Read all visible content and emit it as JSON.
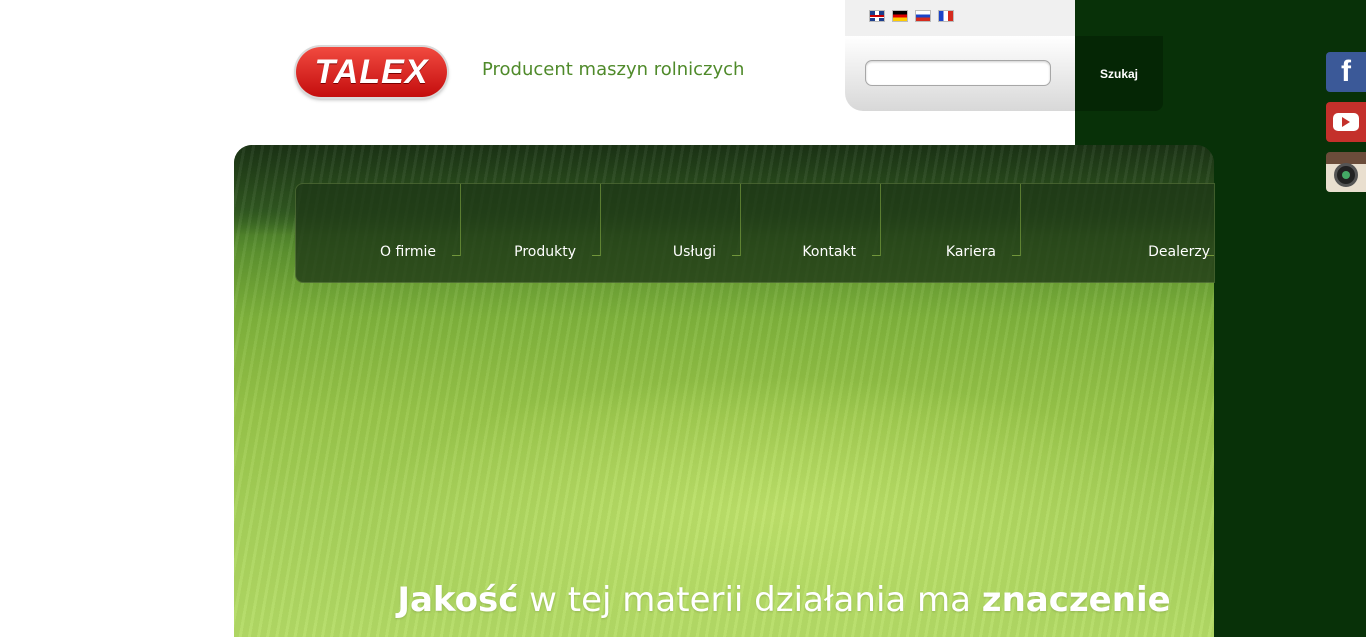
{
  "header": {
    "logo_text": "TALEX",
    "tagline": "Producent maszyn rolniczych",
    "languages": [
      {
        "name": "english-flag-icon"
      },
      {
        "name": "german-flag-icon"
      },
      {
        "name": "russian-flag-icon"
      },
      {
        "name": "french-flag-icon"
      }
    ],
    "search": {
      "value": "",
      "placeholder": "",
      "button_label": "Szukaj"
    }
  },
  "nav": {
    "items": [
      {
        "label": "O firmie"
      },
      {
        "label": "Produkty"
      },
      {
        "label": "Usługi"
      },
      {
        "label": "Kontakt"
      },
      {
        "label": "Kariera"
      },
      {
        "label": "Dealerzy"
      }
    ]
  },
  "hero": {
    "slogan_bold_1": "Jakość",
    "slogan_middle": " w tej materii działania ma ",
    "slogan_bold_2": "znaczenie"
  },
  "social": {
    "facebook_glyph": "f",
    "items": [
      "facebook-icon",
      "youtube-icon",
      "instagram-icon"
    ]
  },
  "colors": {
    "brand_red": "#d9211b",
    "tagline_green": "#4f8a2a",
    "dark_green": "#083108"
  }
}
